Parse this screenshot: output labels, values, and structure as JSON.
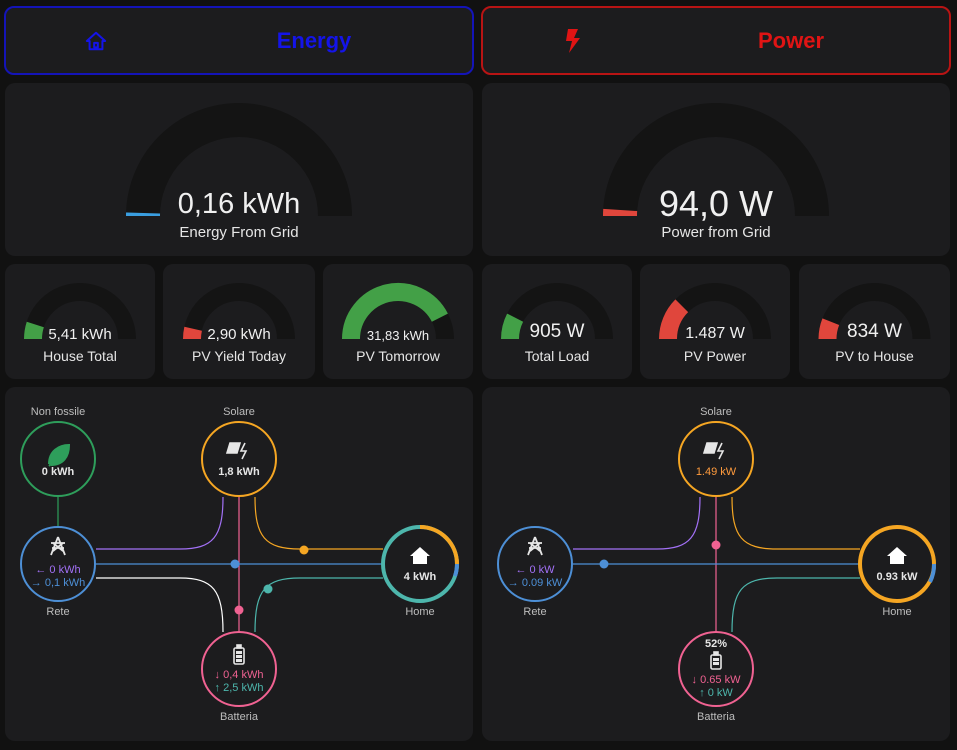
{
  "tabs": [
    {
      "label": "Energy",
      "icon": "home-icon",
      "color": "#1414e8"
    },
    {
      "label": "Power",
      "icon": "lightning-icon",
      "color": "#e01414"
    }
  ],
  "big_gauges": [
    {
      "value": "0,16 kWh",
      "label": "Energy From Grid",
      "fraction": 0.01,
      "color": "#3a9ee0"
    },
    {
      "value": "94,0 W",
      "label": "Power from Grid",
      "fraction": 0.02,
      "color": "#e0463c"
    }
  ],
  "small_gauges": [
    {
      "value": "5,41 kWh",
      "label": "House Total",
      "fraction": 0.1,
      "color": "#43a047"
    },
    {
      "value": "2,90 kWh",
      "label": "PV Yield Today",
      "fraction": 0.07,
      "color": "#e0463c"
    },
    {
      "value": "31,83 kWh",
      "label": "PV Tomorrow",
      "fraction": 0.85,
      "color": "#43a047"
    },
    {
      "value": "905 W",
      "label": "Total Load",
      "fraction": 0.15,
      "color": "#43a047"
    },
    {
      "value": "1.487 W",
      "label": "PV Power",
      "fraction": 0.25,
      "color": "#e0463c"
    },
    {
      "value": "834 W",
      "label": "PV to House",
      "fraction": 0.12,
      "color": "#e0463c"
    }
  ],
  "energy_flow": {
    "non_fossil": {
      "label": "Non fossile",
      "value": "0 kWh"
    },
    "solar": {
      "label": "Solare",
      "value": "1,8 kWh"
    },
    "grid": {
      "label": "Rete",
      "in": "← 0 kWh",
      "out": "→ 0,1 kWh"
    },
    "home": {
      "label": "Home",
      "value": "4 kWh"
    },
    "battery": {
      "label": "Batteria",
      "in": "↓ 0,4 kWh",
      "out": "↑ 2,5 kWh"
    }
  },
  "power_flow": {
    "solar": {
      "label": "Solare",
      "value": "1.49 kW"
    },
    "grid": {
      "label": "Rete",
      "in": "← 0 kW",
      "out": "→ 0.09 kW"
    },
    "home": {
      "label": "Home",
      "value": "0.93 kW"
    },
    "battery": {
      "label": "Batteria",
      "percent": "52%",
      "in": "↓ 0.65 kW",
      "out": "↑ 0 kW"
    }
  },
  "colors": {
    "solar": "#f5a623",
    "grid": "#4d8fd6",
    "battery": "#f06292",
    "non_fossil": "#2e9e5b",
    "home": "#4db6ac",
    "grid_in": "#a371f7",
    "solar_text": "#ff9b3d"
  }
}
